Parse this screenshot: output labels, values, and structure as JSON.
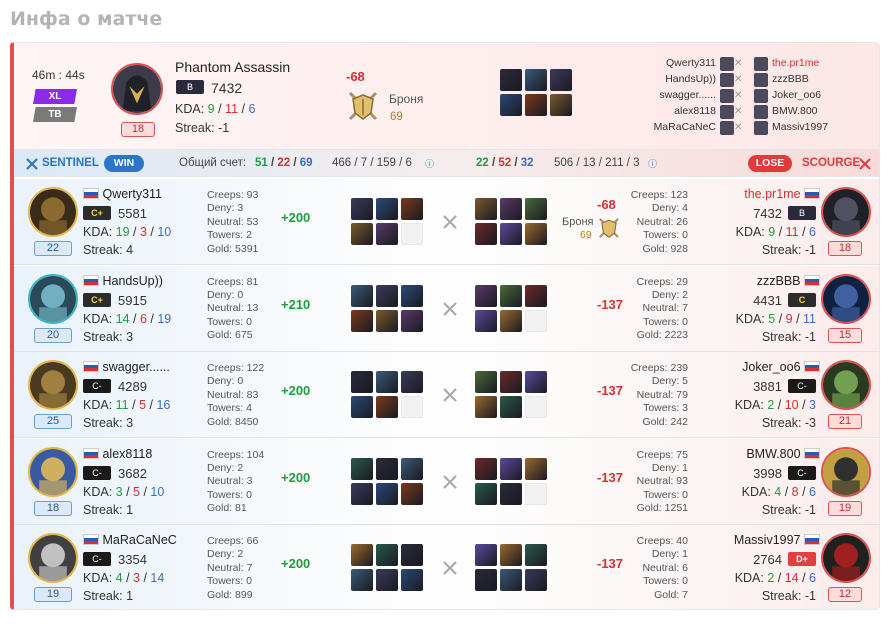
{
  "title": "Инфа о матче",
  "summary": {
    "duration": "46m : 44s",
    "tags": [
      "XL",
      "TB"
    ],
    "hero": "Phantom Assassin",
    "level": "18",
    "rank": "B",
    "mmr": "7432",
    "kda_label": "KDA:",
    "kills": "9",
    "deaths": "11",
    "assists": "6",
    "streak": "Streak: -1",
    "armor_delta": "-68",
    "armor_label": "Броня",
    "armor_value": "69",
    "left_list": [
      "Qwerty311",
      "HandsUp))",
      "swagger......",
      "alex8118",
      "MaRaCaNeC"
    ],
    "right_list": [
      "the.pr1me",
      "zzzBBB",
      "Joker_oo6",
      "BMW.800",
      "Massiv1997"
    ]
  },
  "teams": {
    "sentinel_label": "SENTINEL",
    "win_label": "WIN",
    "score_label": "Общий счет:",
    "left_score": [
      "51",
      "22",
      "69"
    ],
    "left_totals": "466 / 7 / 159 / 6",
    "right_score": [
      "22",
      "52",
      "32"
    ],
    "right_totals": "506 / 13 / 211 / 3",
    "lose_label": "LOSE",
    "scourge_label": "SCOURGE"
  },
  "rows": [
    {
      "left": {
        "name": "Qwerty311",
        "rank": "C+",
        "mmr": "5581",
        "k": "19",
        "d": "3",
        "a": "10",
        "streak": "Streak: 4",
        "level": "22",
        "creeps": "Creeps: 93",
        "deny": "Deny: 3",
        "neutral": "Neutral: 53",
        "towers": "Towers: 2",
        "gold": "Gold: 5391"
      },
      "gain": "+200",
      "loss": "-68",
      "armor_label": "Броня",
      "armor_value": "69",
      "right": {
        "name": "the.pr1me",
        "rank": "B",
        "mmr": "7432",
        "k": "9",
        "d": "11",
        "a": "6",
        "streak": "Streak: -1",
        "level": "18",
        "creeps": "Creeps: 123",
        "deny": "Deny: 4",
        "neutral": "Neutral: 26",
        "towers": "Towers: 0",
        "gold": "Gold: 928"
      }
    },
    {
      "left": {
        "name": "HandsUp))",
        "rank": "C+",
        "mmr": "5915",
        "k": "14",
        "d": "6",
        "a": "19",
        "streak": "Streak: 3",
        "level": "20",
        "creeps": "Creeps: 81",
        "deny": "Deny: 0",
        "neutral": "Neutral: 13",
        "towers": "Towers: 0",
        "gold": "Gold: 675"
      },
      "gain": "+210",
      "loss": "-137",
      "right": {
        "name": "zzzBBB",
        "rank": "C",
        "mmr": "4431",
        "k": "5",
        "d": "9",
        "a": "11",
        "streak": "Streak: -1",
        "level": "15",
        "creeps": "Creeps: 29",
        "deny": "Deny: 2",
        "neutral": "Neutral: 7",
        "towers": "Towers: 0",
        "gold": "Gold: 2223"
      }
    },
    {
      "left": {
        "name": "swagger......",
        "rank": "C-",
        "mmr": "4289",
        "k": "11",
        "d": "5",
        "a": "16",
        "streak": "Streak: 3",
        "level": "25",
        "creeps": "Creeps: 122",
        "deny": "Deny: 0",
        "neutral": "Neutral: 83",
        "towers": "Towers: 4",
        "gold": "Gold: 8450"
      },
      "gain": "+200",
      "loss": "-137",
      "right": {
        "name": "Joker_oo6",
        "rank": "C-",
        "mmr": "3881",
        "k": "2",
        "d": "10",
        "a": "3",
        "streak": "Streak: -3",
        "level": "21",
        "creeps": "Creeps: 239",
        "deny": "Deny: 5",
        "neutral": "Neutral: 79",
        "towers": "Towers: 3",
        "gold": "Gold: 242"
      }
    },
    {
      "left": {
        "name": "alex8118",
        "rank": "C-",
        "mmr": "3682",
        "k": "3",
        "d": "5",
        "a": "10",
        "streak": "Streak: 1",
        "level": "18",
        "creeps": "Creeps: 104",
        "deny": "Deny: 2",
        "neutral": "Neutral: 3",
        "towers": "Towers: 0",
        "gold": "Gold: 81"
      },
      "gain": "+200",
      "loss": "-137",
      "right": {
        "name": "BMW.800",
        "rank": "C-",
        "mmr": "3998",
        "k": "4",
        "d": "8",
        "a": "6",
        "streak": "Streak: -1",
        "level": "19",
        "creeps": "Creeps: 75",
        "deny": "Deny: 1",
        "neutral": "Neutral: 93",
        "towers": "Towers: 0",
        "gold": "Gold: 1251"
      }
    },
    {
      "left": {
        "name": "MaRaCaNeC",
        "rank": "C-",
        "mmr": "3354",
        "k": "4",
        "d": "3",
        "a": "14",
        "streak": "Streak: 1",
        "level": "19",
        "creeps": "Creeps: 66",
        "deny": "Deny: 2",
        "neutral": "Neutral: 7",
        "towers": "Towers: 0",
        "gold": "Gold: 899"
      },
      "gain": "+200",
      "loss": "-137",
      "right": {
        "name": "Massiv1997",
        "rank": "D+",
        "mmr": "2764",
        "k": "2",
        "d": "14",
        "a": "6",
        "streak": "Streak: -1",
        "level": "12",
        "creeps": "Creeps: 40",
        "deny": "Deny: 1",
        "neutral": "Neutral: 6",
        "towers": "Towers: 0",
        "gold": "Gold: 7"
      }
    }
  ],
  "colors": {
    "win": "#2b74c8",
    "lose": "#e03a3a",
    "gain": "#1e9e3e",
    "loss": "#d63030",
    "accent_border": "#e05050"
  },
  "icons": [
    "portrait-icon",
    "item-icon",
    "armor-icon",
    "sentinel-icon",
    "scourge-icon",
    "crossed-swords-icon",
    "info-icon",
    "flag-icon"
  ]
}
